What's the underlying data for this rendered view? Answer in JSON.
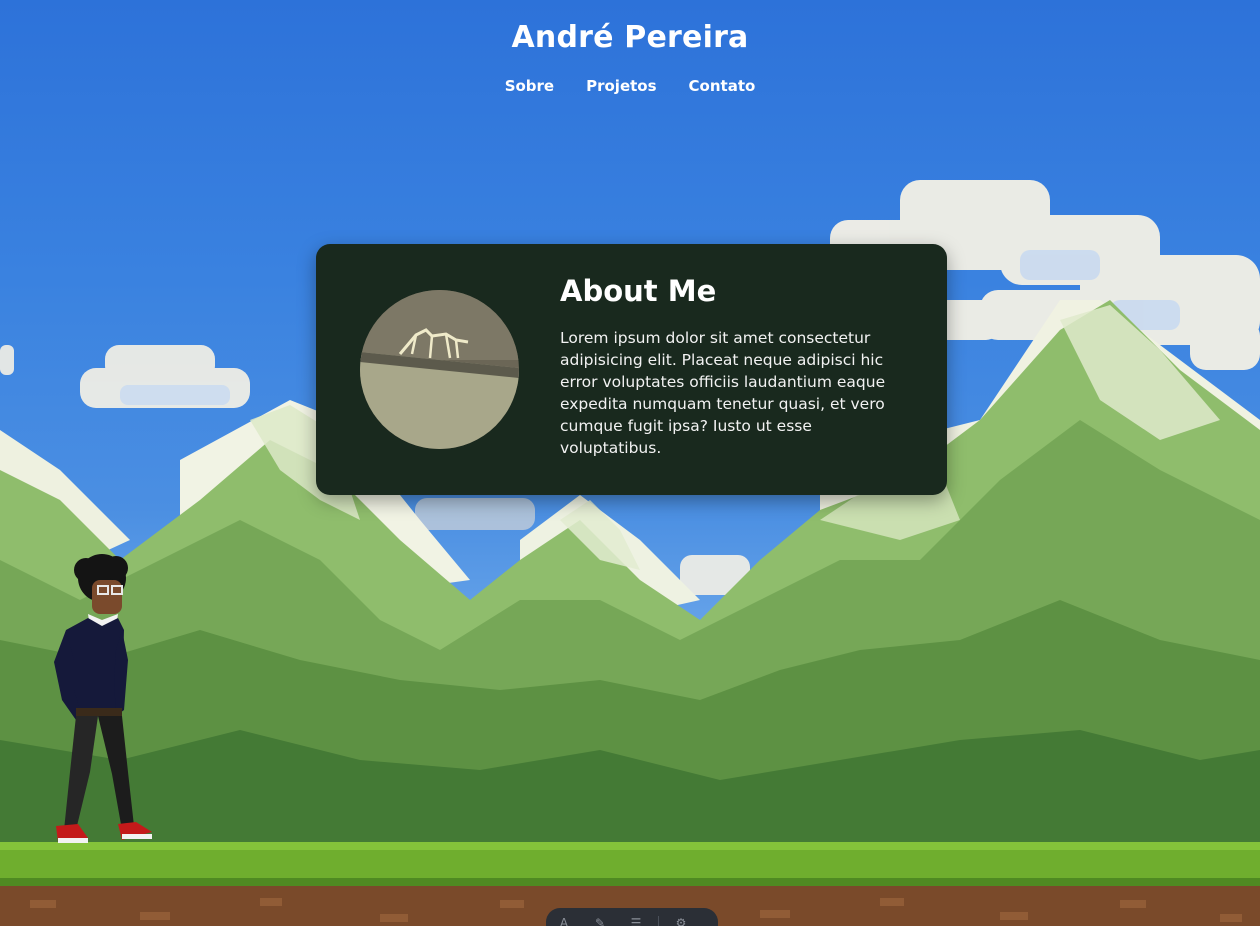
{
  "header": {
    "title": "André Pereira",
    "nav": [
      "Sobre",
      "Projetos",
      "Contato"
    ]
  },
  "about": {
    "title": "About Me",
    "body": "Lorem ipsum dolor sit amet consectetur adipisicing elit. Placeat neque adipisci hic error voluptates officiis laudantium eaque expedita numquam tenetur quasi, et vero cumque fugit ipsa? Iusto ut esse voluptatibus.",
    "avatar_icon": "profile-photo"
  },
  "colors": {
    "sky": "#3a82e0",
    "card": "#19291e",
    "grass": "#6fae2e",
    "dirt": "#7a4a2a",
    "text": "#ffffff"
  },
  "dock": {
    "icons": [
      "text-icon",
      "brush-icon",
      "menu-icon",
      "settings-icon"
    ]
  }
}
